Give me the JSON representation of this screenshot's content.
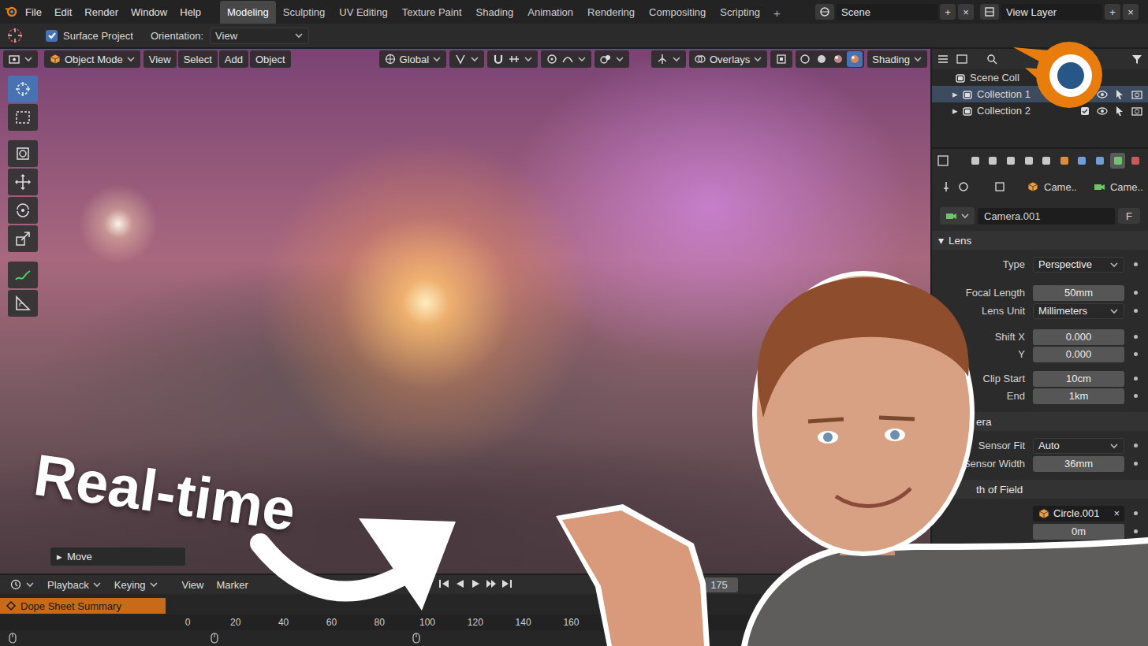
{
  "menu": [
    "File",
    "Edit",
    "Render",
    "Window",
    "Help"
  ],
  "workspaces": [
    {
      "label": "Modeling",
      "selected": true
    },
    {
      "label": "Sculpting",
      "selected": false
    },
    {
      "label": "UV Editing",
      "selected": false
    },
    {
      "label": "Texture Paint",
      "selected": false
    },
    {
      "label": "Shading",
      "selected": false
    },
    {
      "label": "Animation",
      "selected": false
    },
    {
      "label": "Rendering",
      "selected": false
    },
    {
      "label": "Compositing",
      "selected": false
    },
    {
      "label": "Scripting",
      "selected": false
    }
  ],
  "add_workspace": "+",
  "scene": {
    "label": "Scene",
    "add": "+",
    "remove": "×"
  },
  "view_layer": {
    "label": "View Layer",
    "add": "+",
    "remove": "×"
  },
  "tool_settings": {
    "surface_project": {
      "label": "Surface Project",
      "checked": true
    },
    "orientation_label": "Orientation:",
    "orientation": "View"
  },
  "viewport_header": {
    "mode": "Object Mode",
    "menus": [
      "View",
      "Select",
      "Add",
      "Object"
    ],
    "transform_orientation": "Global",
    "overlays": "Overlays",
    "shading": "Shading",
    "shading_modes": [
      {
        "selected": false
      },
      {
        "selected": false
      },
      {
        "selected": false
      },
      {
        "selected": true
      }
    ]
  },
  "toolbar": [
    {
      "kind": "cursor",
      "selected": true
    },
    {
      "kind": "select",
      "selected": false
    },
    {
      "kind": "transform",
      "selected": false
    },
    {
      "kind": "move",
      "selected": false
    },
    {
      "kind": "rotate",
      "selected": false
    },
    {
      "kind": "scale",
      "selected": false
    },
    {
      "kind": "annotate",
      "selected": false
    },
    {
      "kind": "measure",
      "selected": false
    }
  ],
  "last_operator": {
    "arrow": "▸",
    "label": "Move"
  },
  "thumbnail": {
    "caption": "Real-time"
  },
  "outliner": {
    "items": [
      {
        "kind": "scene",
        "expand": "",
        "label": "Scene Coll",
        "selected": false
      },
      {
        "kind": "collection",
        "expand": "▸",
        "label": "Collection 1",
        "selected": true
      },
      {
        "kind": "collection",
        "expand": "▸",
        "label": "Collection 2",
        "selected": false
      }
    ]
  },
  "properties": {
    "tabs": [
      {
        "selected": false
      },
      {
        "selected": false
      },
      {
        "selected": false
      },
      {
        "selected": false
      },
      {
        "selected": false
      },
      {
        "selected": false
      },
      {
        "selected": false
      },
      {
        "selected": false
      },
      {
        "selected": true
      },
      {
        "selected": false
      }
    ],
    "breadcrumb": [
      "Came..",
      "Came.."
    ],
    "datablock": "Camera.001",
    "fake_user": "F",
    "sections": [
      {
        "title": "Lens",
        "arrow": "▾",
        "expanded": true,
        "rows": [
          {
            "label": "Type",
            "value": "Perspective",
            "kind": "dropdown"
          },
          {
            "label": "Focal Length",
            "value": "50mm",
            "kind": "number"
          },
          {
            "label": "Lens Unit",
            "value": "Millimeters",
            "kind": "dropdown"
          },
          {
            "label": "Shift X",
            "value": "0.000",
            "kind": "number"
          },
          {
            "label": "Y",
            "value": "0.000",
            "kind": "number"
          },
          {
            "label": "Clip Start",
            "value": "10cm",
            "kind": "number"
          },
          {
            "label": "End",
            "value": "1km",
            "kind": "number"
          }
        ]
      },
      {
        "title": "era",
        "arrow": "",
        "expanded": true,
        "rows": [
          {
            "label": "Sensor Fit",
            "value": "Auto",
            "kind": "dropdown"
          },
          {
            "label": "Sensor Width",
            "value": "36mm",
            "kind": "number"
          }
        ]
      },
      {
        "title": "th of Field",
        "arrow": "",
        "expanded": true,
        "rows": [
          {
            "label": "",
            "value": "Circle.001",
            "kind": "object",
            "clear": "×"
          },
          {
            "label": "",
            "value": "0m",
            "kind": "number"
          }
        ]
      }
    ]
  },
  "timeline": {
    "menus": [
      "Playback",
      "Keying",
      "View",
      "Marker"
    ],
    "end_frame": "175",
    "summary": "Dope Sheet Summary",
    "ruler": [
      "0",
      "20",
      "40",
      "60",
      "80",
      "100",
      "120",
      "140",
      "160"
    ]
  }
}
